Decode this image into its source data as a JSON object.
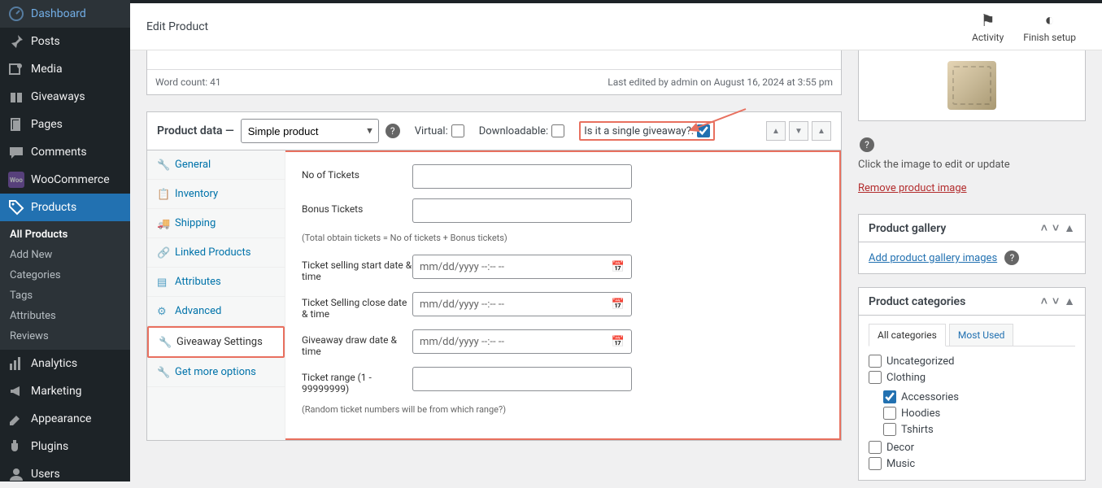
{
  "sidebar": {
    "items": [
      {
        "label": "Dashboard",
        "icon": "dashboard"
      },
      {
        "label": "Posts",
        "icon": "pin"
      },
      {
        "label": "Media",
        "icon": "media"
      },
      {
        "label": "Giveaways",
        "icon": "gift"
      },
      {
        "label": "Pages",
        "icon": "pages"
      },
      {
        "label": "Comments",
        "icon": "comments"
      },
      {
        "label": "WooCommerce",
        "icon": "woo"
      },
      {
        "label": "Products",
        "icon": "products"
      },
      {
        "label": "Analytics",
        "icon": "analytics"
      },
      {
        "label": "Marketing",
        "icon": "marketing"
      },
      {
        "label": "Appearance",
        "icon": "appearance"
      },
      {
        "label": "Plugins",
        "icon": "plugins"
      },
      {
        "label": "Users",
        "icon": "users"
      }
    ],
    "products_sub": [
      "All Products",
      "Add New",
      "Categories",
      "Tags",
      "Attributes",
      "Reviews"
    ]
  },
  "header": {
    "title": "Edit Product",
    "activity": "Activity",
    "finish": "Finish setup"
  },
  "editor": {
    "word_count": "Word count: 41",
    "last_edited": "Last edited by admin on August 16, 2024 at 3:55 pm"
  },
  "product_data": {
    "title": "Product data —",
    "type_selected": "Simple product",
    "virtual_label": "Virtual:",
    "downloadable_label": "Downloadable:",
    "single_giveaway_label": "Is it a single giveaway?:",
    "single_giveaway_checked": true,
    "tabs": [
      "General",
      "Inventory",
      "Shipping",
      "Linked Products",
      "Attributes",
      "Advanced",
      "Giveaway Settings",
      "Get more options"
    ],
    "form": {
      "no_tickets_label": "No of Tickets",
      "bonus_tickets_label": "Bonus Tickets",
      "bonus_note": "(Total obtain tickets = No of tickets + Bonus tickets)",
      "start_label": "Ticket selling start date & time",
      "close_label": "Ticket Selling close date & time",
      "draw_label": "Giveaway draw date & time",
      "range_label": "Ticket range (1 - 99999999)",
      "range_note": "(Random ticket numbers will be from which range?)",
      "dt_placeholder": "mm/dd/yyyy --:-- --"
    }
  },
  "side": {
    "image_hint": "Click the image to edit or update",
    "remove_image": "Remove product image",
    "gallery_title": "Product gallery",
    "add_gallery": "Add product gallery images",
    "categories_title": "Product categories",
    "cat_tab_all": "All categories",
    "cat_tab_used": "Most Used",
    "cats": {
      "uncategorized": "Uncategorized",
      "clothing": "Clothing",
      "accessories": "Accessories",
      "hoodies": "Hoodies",
      "tshirts": "Tshirts",
      "decor": "Decor",
      "music": "Music"
    }
  }
}
